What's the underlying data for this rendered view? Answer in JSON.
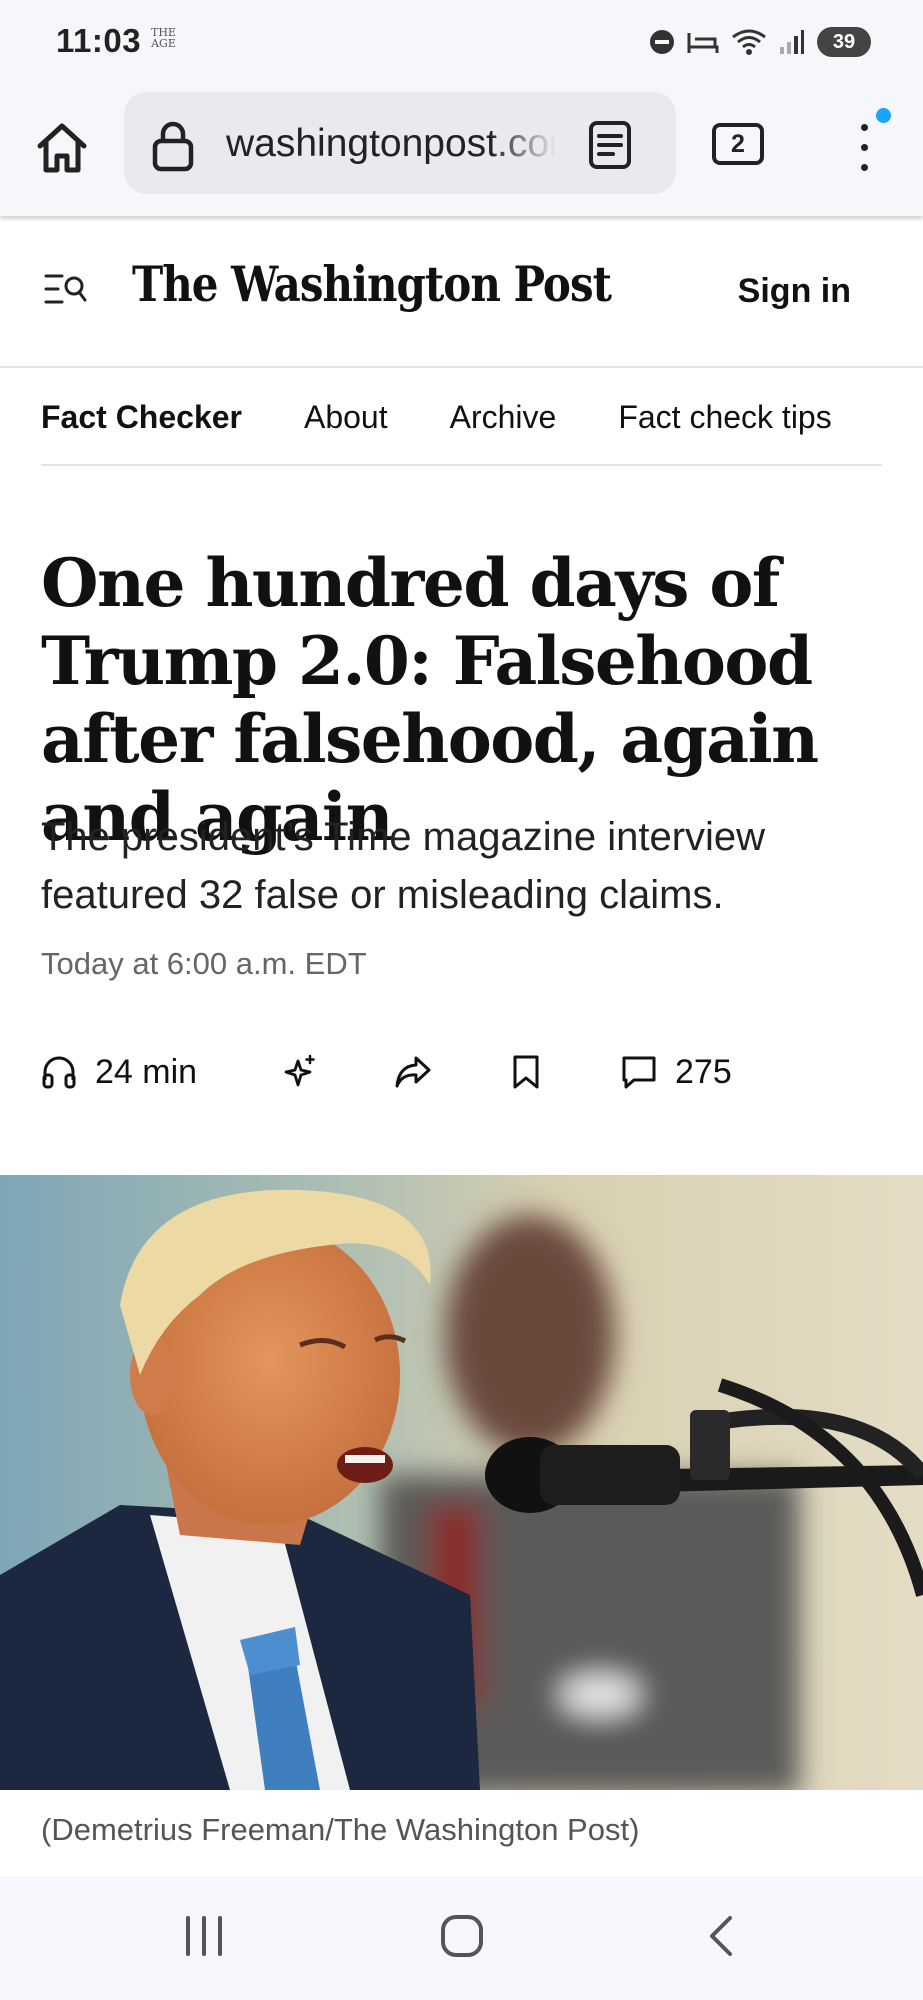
{
  "status_bar": {
    "time": "11:03",
    "app_badge_line1": "THE",
    "app_badge_line2": "AGE",
    "battery": "39",
    "icons": [
      "do-not-disturb-icon",
      "sleep-mode-icon",
      "wifi-icon",
      "signal-icon",
      "battery-icon"
    ]
  },
  "browser": {
    "url": "washingtonpost.com",
    "tab_count": "2",
    "icons": [
      "home-icon",
      "lock-icon",
      "reader-mode-icon",
      "tabs-icon",
      "more-menu-icon"
    ]
  },
  "site_header": {
    "logo_text": "The Washington Post",
    "sign_in": "Sign in"
  },
  "section_nav": {
    "items": [
      "Fact Checker",
      "About",
      "Archive",
      "Fact check tips"
    ]
  },
  "article": {
    "headline": "One hundred days of Trump 2.0: Falsehood after falsehood, again and again",
    "dek": "The president’s Time magazine interview featured 32 false or misleading claims.",
    "dateline": "Today at 6:00 a.m. EDT",
    "listen_duration": "24 min",
    "comment_count": "275",
    "photo_caption": "(Demetrius Freeman/The Washington Post)"
  },
  "colors": {
    "chrome_bg": "#f6f7fa",
    "urlbar_bg": "#e8eaef",
    "notification_dot": "#1aa3ff",
    "text": "#111111",
    "muted": "#666666"
  }
}
